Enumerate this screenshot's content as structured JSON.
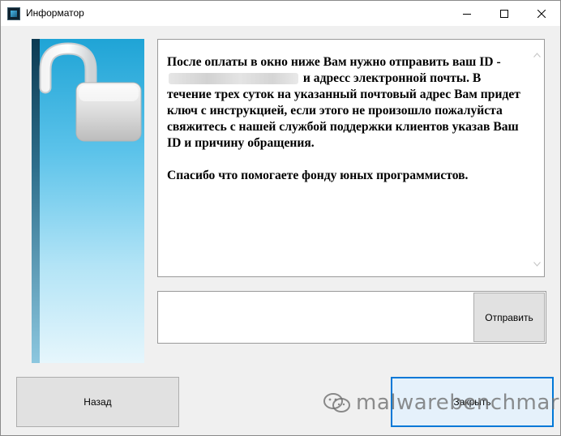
{
  "window": {
    "title": "Информатор",
    "icon": "app-icon"
  },
  "message": {
    "line_before_id": "После оплаты в окно ниже Вам нужно отправить ваш ID -",
    "line_after_id": "и адресс электронной почты. В течение трех суток на указанный почтовый адрес Вам придет ключ с инструкцией, если этого не произошло пожалуйста свяжитесь с нашей службой поддержки клиентов указав Ваш ID и причину обращения.",
    "thanks": "Спасибо что помогаете фонду юных программистов."
  },
  "reply": {
    "value": "",
    "send_label": "Отправить"
  },
  "buttons": {
    "back_label": "Назад",
    "close_label": "Закрыть"
  },
  "watermark": {
    "text": "malwarebenchmark",
    "icon": "wechat-icon"
  },
  "colors": {
    "accent": "#0078d7",
    "panel_top": "#1fa4d6",
    "panel_bottom": "#e6f6fc"
  }
}
